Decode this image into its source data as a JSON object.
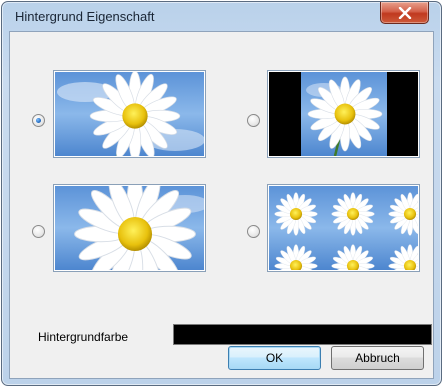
{
  "window": {
    "title": "Hintergrund Eigenschaft"
  },
  "options": [
    {
      "id": "center",
      "checked": true
    },
    {
      "id": "fit",
      "checked": false
    },
    {
      "id": "stretch",
      "checked": false
    },
    {
      "id": "tile",
      "checked": false
    }
  ],
  "background_color": {
    "label": "Hintergrundfarbe",
    "value": "#000000"
  },
  "buttons": {
    "ok": "OK",
    "cancel": "Abbruch"
  },
  "colors": {
    "accent": "#1b62b8",
    "close": "#c0391f"
  }
}
